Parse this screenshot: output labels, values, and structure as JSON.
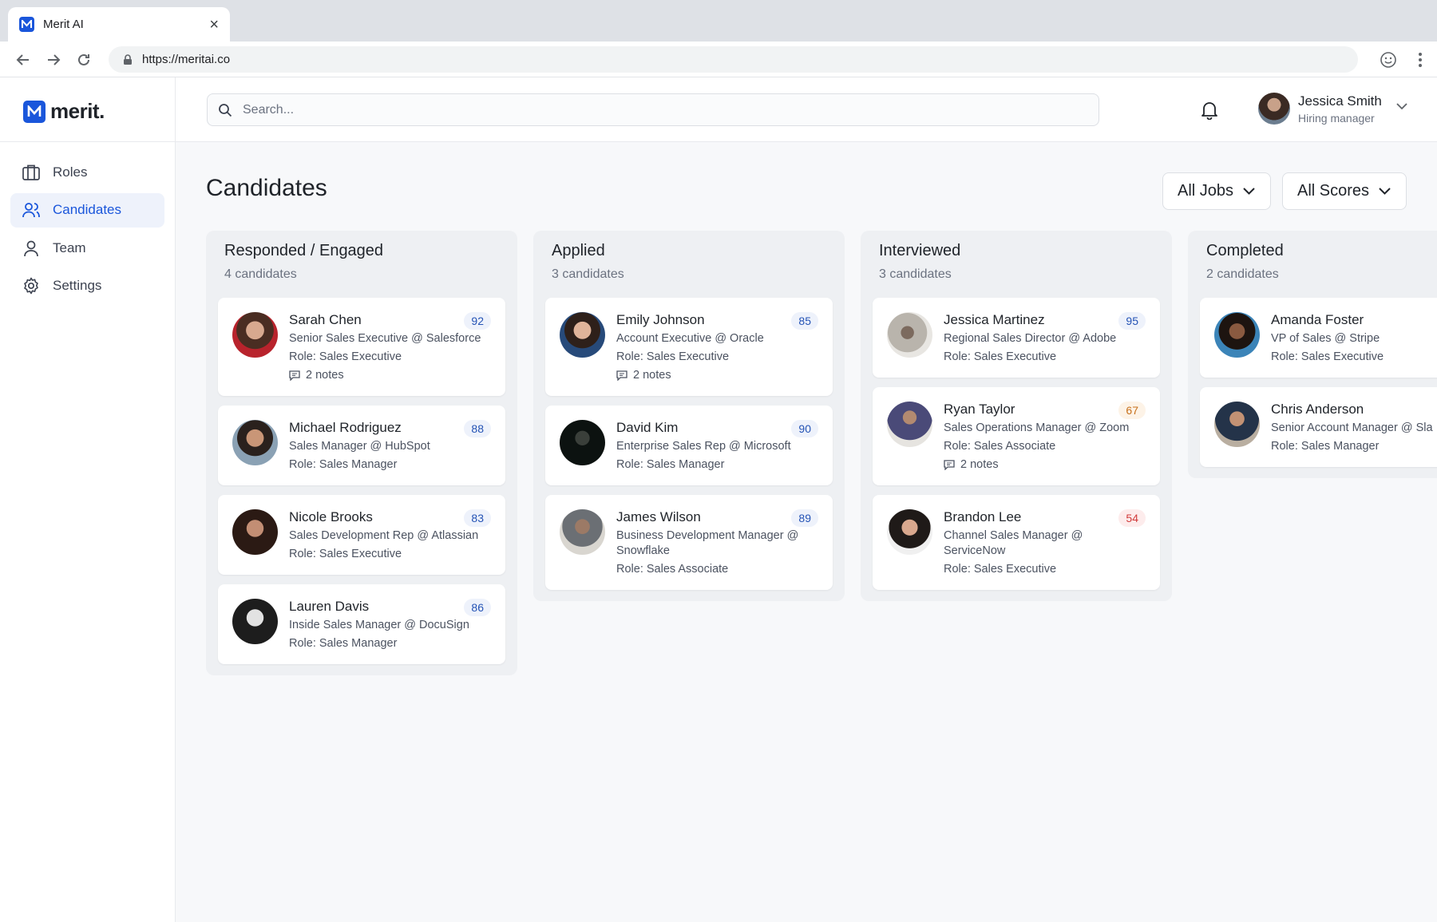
{
  "browser": {
    "tab_title": "Merit AI",
    "url": "https://meritai.co"
  },
  "brand": {
    "name": "merit."
  },
  "sidebar": {
    "items": [
      {
        "label": "Roles",
        "icon": "briefcase-icon",
        "active": false
      },
      {
        "label": "Candidates",
        "icon": "users-icon",
        "active": true
      },
      {
        "label": "Team",
        "icon": "user-icon",
        "active": false
      },
      {
        "label": "Settings",
        "icon": "gear-icon",
        "active": false
      }
    ]
  },
  "header": {
    "search_placeholder": "Search...",
    "user": {
      "name": "Jessica Smith",
      "role": "Hiring manager"
    }
  },
  "page": {
    "title": "Candidates",
    "filters": {
      "jobs": "All Jobs",
      "scores": "All Scores"
    }
  },
  "colors": {
    "accent": "#1a56db",
    "score_high": "#2453b5",
    "score_mid": "#c7701b",
    "score_low": "#d13b3b"
  },
  "columns": [
    {
      "title": "Responded / Engaged",
      "count": "4 candidates",
      "cards": [
        {
          "name": "Sarah Chen",
          "title": "Senior Sales Executive @ Salesforce",
          "role": "Role: Sales Executive",
          "notes": "2 notes",
          "score": "92",
          "level": "high"
        },
        {
          "name": "Michael Rodriguez",
          "title": "Sales Manager @ HubSpot",
          "role": "Role: Sales Manager",
          "notes": "",
          "score": "88",
          "level": "high"
        },
        {
          "name": "Nicole Brooks",
          "title": "Sales Development Rep @ Atlassian",
          "role": "Role: Sales Executive",
          "notes": "",
          "score": "83",
          "level": "high"
        },
        {
          "name": "Lauren Davis",
          "title": "Inside Sales Manager @ DocuSign",
          "role": "Role: Sales Manager",
          "notes": "",
          "score": "86",
          "level": "high"
        }
      ]
    },
    {
      "title": "Applied",
      "count": "3 candidates",
      "cards": [
        {
          "name": "Emily Johnson",
          "title": "Account Executive @ Oracle",
          "role": "Role: Sales Executive",
          "notes": "2 notes",
          "score": "85",
          "level": "high"
        },
        {
          "name": "David Kim",
          "title": "Enterprise Sales Rep @ Microsoft",
          "role": "Role: Sales Manager",
          "notes": "",
          "score": "90",
          "level": "high"
        },
        {
          "name": "James Wilson",
          "title": "Business Development Manager @ Snowflake",
          "role": "Role: Sales Associate",
          "notes": "",
          "score": "89",
          "level": "high"
        }
      ]
    },
    {
      "title": "Interviewed",
      "count": "3 candidates",
      "cards": [
        {
          "name": "Jessica Martinez",
          "title": "Regional Sales Director @ Adobe",
          "role": "Role: Sales Executive",
          "notes": "",
          "score": "95",
          "level": "high"
        },
        {
          "name": "Ryan Taylor",
          "title": "Sales Operations Manager @ Zoom",
          "role": "Role: Sales Associate",
          "notes": "2 notes",
          "score": "67",
          "level": "mid"
        },
        {
          "name": "Brandon Lee",
          "title": "Channel Sales Manager @ ServiceNow",
          "role": "Role: Sales Executive",
          "notes": "",
          "score": "54",
          "level": "low"
        }
      ]
    },
    {
      "title": "Completed",
      "count": "2 candidates",
      "cards": [
        {
          "name": "Amanda Foster",
          "title": "VP of Sales @ Stripe",
          "role": "Role: Sales Executive",
          "notes": "",
          "score": "",
          "level": "high"
        },
        {
          "name": "Chris Anderson",
          "title": "Senior Account Manager @ Sla",
          "role": "Role: Sales Manager",
          "notes": "",
          "score": "",
          "level": "high"
        }
      ]
    }
  ]
}
